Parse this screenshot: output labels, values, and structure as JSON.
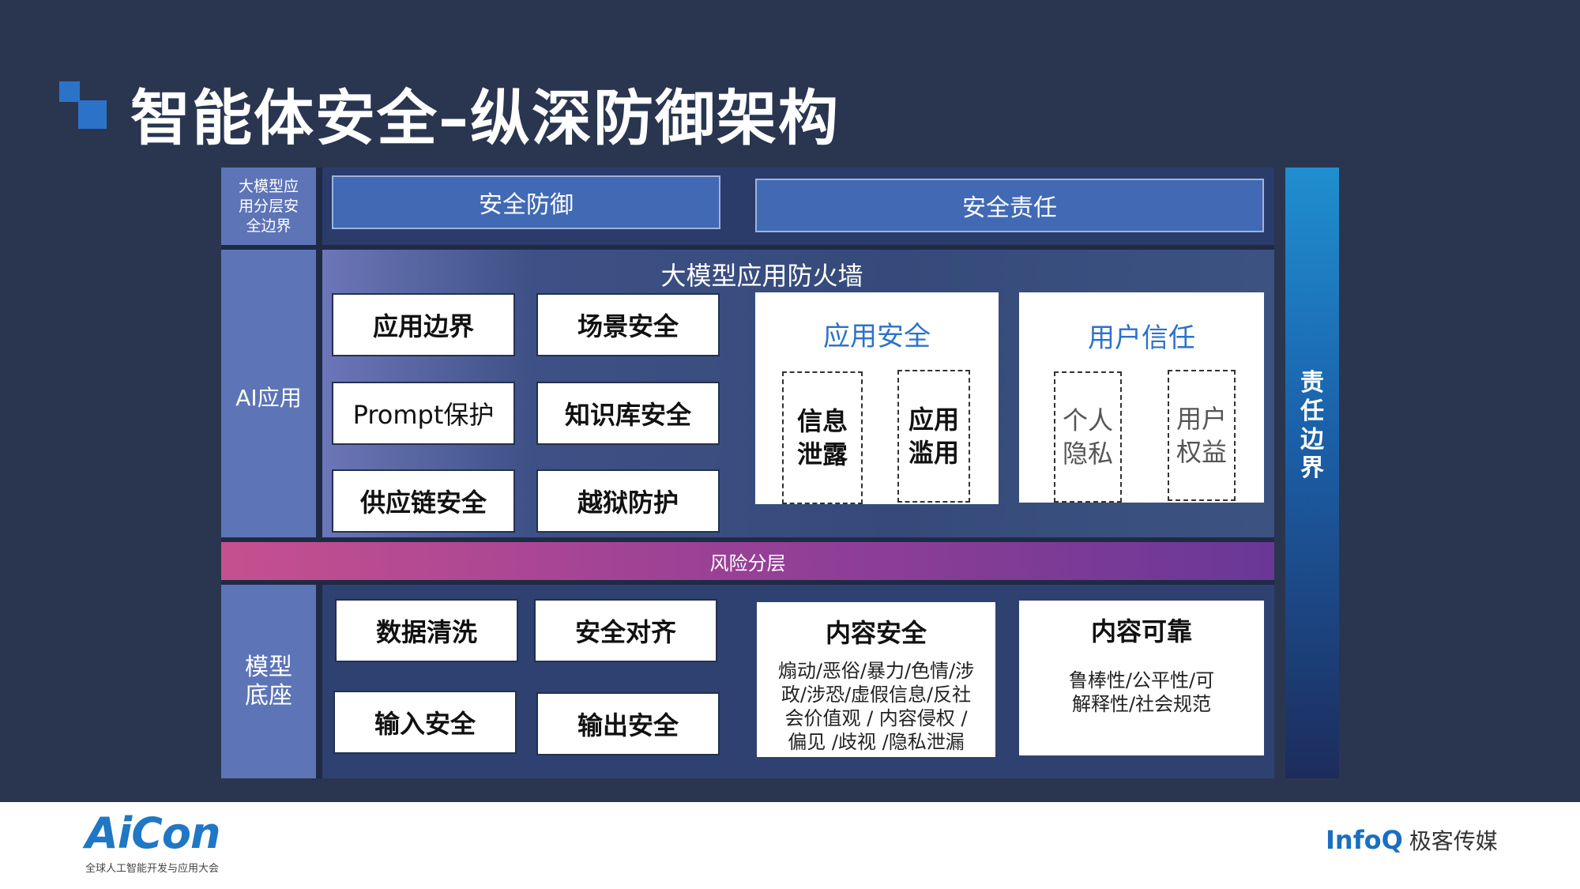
{
  "title": "智能体安全–纵深防御架构",
  "layers": {
    "boundary_label_lines": [
      "大模型应",
      "用分层安",
      "全边界"
    ],
    "ai_app_label": "AI应用",
    "model_base_label_lines": [
      "模型",
      "底座"
    ]
  },
  "top": {
    "defense": "安全防御",
    "responsibility": "安全责任"
  },
  "firewall": {
    "title": "大模型应用防火墙",
    "boxes": [
      "应用边界",
      "场景安全",
      "Prompt保护",
      "知识库安全",
      "供应链安全",
      "越狱防护"
    ],
    "app_security": {
      "title": "应用安全",
      "items": [
        [
          "信息",
          "泄露"
        ],
        [
          "应用",
          "滥用"
        ]
      ]
    },
    "user_trust": {
      "title": "用户信任",
      "items": [
        [
          "个人",
          "隐私"
        ],
        [
          "用户",
          "权益"
        ]
      ]
    }
  },
  "risk_layer": "风险分层",
  "model_base": {
    "boxes": [
      "数据清洗",
      "安全对齐",
      "输入安全",
      "输出安全"
    ],
    "content_security": {
      "title": "内容安全",
      "lines": [
        "煽动/恶俗/暴力/色情/涉",
        "政/涉恐/虚假信息/反社",
        "会价值观 / 内容侵权 /",
        "偏见 /歧视 /隐私泄漏"
      ]
    },
    "content_reliable": {
      "title": "内容可靠",
      "lines": [
        "鲁棒性/公平性/可",
        "解释性/社会规范"
      ]
    }
  },
  "responsibility_boundary": [
    "责",
    "任",
    "边",
    "界"
  ],
  "footer": {
    "aicon_logo": "AiCon",
    "aicon_sub": "全球人工智能开发与应用大会",
    "infoq": "InfoQ",
    "geek": "极客传媒"
  }
}
